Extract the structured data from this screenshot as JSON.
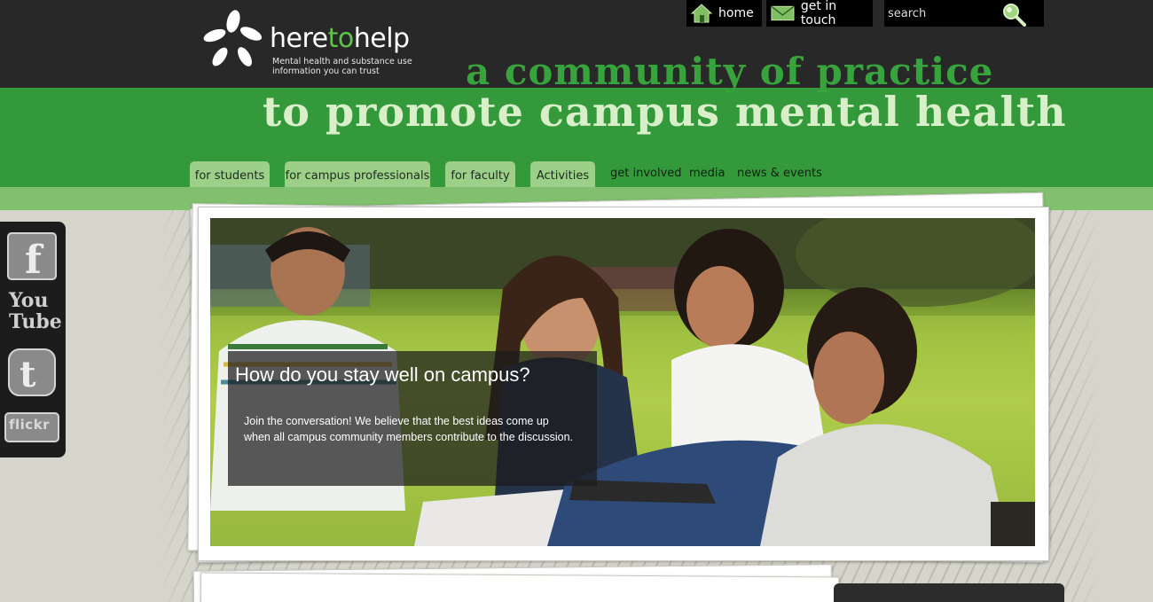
{
  "brand": {
    "name_here": "here",
    "name_to": "to",
    "name_help": "help",
    "tagline_line1": "Mental health and substance use",
    "tagline_line2": "information you can trust",
    "accent": "#5cc54a"
  },
  "utility": {
    "home_label": "home",
    "touch_label": "get in touch",
    "search_placeholder": "search"
  },
  "slogan": {
    "line1": "a community of practice",
    "line2": "to promote campus mental health"
  },
  "nav": {
    "tabs": [
      "for students",
      "for campus professionals",
      "for faculty",
      "Activities"
    ],
    "links": [
      "get involved",
      "media",
      "news & events"
    ]
  },
  "hero": {
    "title": "How do you stay well on campus?",
    "body": "Join the conversation! We believe that the best ideas come up when all campus community members contribute to the discussion."
  },
  "social": {
    "facebook_letter": "f",
    "youtube_line1": "You",
    "youtube_line2": "Tube",
    "twitter_letter": "t",
    "flickr_label": "flickr"
  },
  "colors": {
    "header_bg": "#282828",
    "band_green": "#33993a",
    "tab_green": "#9cd088",
    "slogan_light": "#d9efc9"
  }
}
